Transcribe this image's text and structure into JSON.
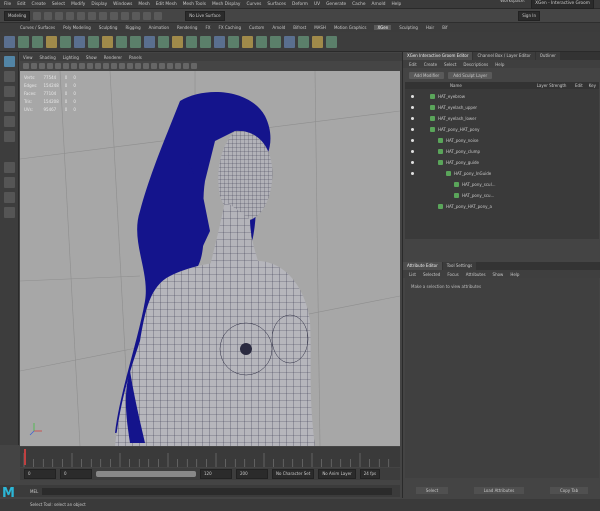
{
  "menubar": {
    "items": [
      "File",
      "Edit",
      "Create",
      "Select",
      "Modify",
      "Display",
      "Windows",
      "Mesh",
      "Edit Mesh",
      "Mesh Tools",
      "Mesh Display",
      "Curves",
      "Surfaces",
      "Deform",
      "UV",
      "Generate",
      "Cache",
      "Arnold",
      "Help"
    ],
    "workspace_label": "Workspace:",
    "workspace_value": "XGen - Interactive Groom"
  },
  "statusline": {
    "mode": "Modeling",
    "live_surface": "No Live Surface",
    "sign_in": "Sign In"
  },
  "shelf": {
    "tabs": [
      "Curves / Surfaces",
      "Poly Modeling",
      "Sculpting",
      "Rigging",
      "Animation",
      "Rendering",
      "FX",
      "FX Caching",
      "Custom",
      "Arnold",
      "Bifrost",
      "MASH",
      "Motion Graphics",
      "XGen",
      "Sculpting",
      "Hair",
      "Bif"
    ],
    "active_tab_index": 13
  },
  "viewport": {
    "menu": [
      "View",
      "Shading",
      "Lighting",
      "Show",
      "Renderer",
      "Panels"
    ],
    "hud": [
      {
        "label": "Verts:",
        "a": "77544",
        "b": "0",
        "c": "0"
      },
      {
        "label": "Edges:",
        "a": "154248",
        "b": "0",
        "c": "0"
      },
      {
        "label": "Faces:",
        "a": "77104",
        "b": "0",
        "c": "0"
      },
      {
        "label": "Tris:",
        "a": "154208",
        "b": "0",
        "c": "0"
      },
      {
        "label": "UVs:",
        "a": "95467",
        "b": "0",
        "c": "0"
      }
    ],
    "colors": {
      "background": "#a7a7a7",
      "hair": "#14148c",
      "skin_wire": "#2a2a40"
    }
  },
  "timeline": {
    "start": "0",
    "end": "120",
    "range_start": "0",
    "range_end": "200",
    "char_set": "No Character Set",
    "anim_layer": "No Anim Layer",
    "fps": "24 fps"
  },
  "cmdline": {
    "label": "MEL"
  },
  "help": {
    "text": "Select Tool: select an object"
  },
  "panel": {
    "tabs": [
      "XGen Interactive Groom Editor",
      "Channel Box / Layer Editor",
      "Outliner"
    ],
    "menu": [
      "Edit",
      "Create",
      "Select",
      "Descriptions",
      "Help"
    ],
    "buttons": [
      "Add Modifier",
      "Add Sculpt Layer"
    ],
    "columns": [
      "Name",
      "Layer Strength",
      "Edit",
      "Key"
    ],
    "tree": [
      {
        "indent": 0,
        "label": "HAT_eyebrow",
        "eye": true
      },
      {
        "indent": 0,
        "label": "HAT_eyelash_upper",
        "eye": true
      },
      {
        "indent": 0,
        "label": "HAT_eyelash_lower",
        "eye": true
      },
      {
        "indent": 0,
        "label": "HAT_pony_HAT_pony",
        "eye": true
      },
      {
        "indent": 1,
        "label": "HAT_pony_noise",
        "eye": true
      },
      {
        "indent": 1,
        "label": "HAT_pony_clump",
        "eye": true
      },
      {
        "indent": 1,
        "label": "HAT_pony_guide",
        "eye": true
      },
      {
        "indent": 2,
        "label": "HAT_pony_InGuide",
        "eye": true
      },
      {
        "indent": 3,
        "label": "HAT_pony_scul...",
        "eye": false
      },
      {
        "indent": 3,
        "label": "HAT_pony_scu...",
        "eye": false
      },
      {
        "indent": 1,
        "label": "HAT_pony_HAT_pony_a",
        "eye": false
      }
    ]
  },
  "attr": {
    "tabs": [
      "Attribute Editor",
      "Tool Settings"
    ],
    "menu": [
      "List",
      "Selected",
      "Focus",
      "Attributes",
      "Show",
      "Help"
    ],
    "message": "Make a selection to view attributes",
    "footer": [
      "Select",
      "Load Attributes",
      "Copy Tab"
    ]
  }
}
